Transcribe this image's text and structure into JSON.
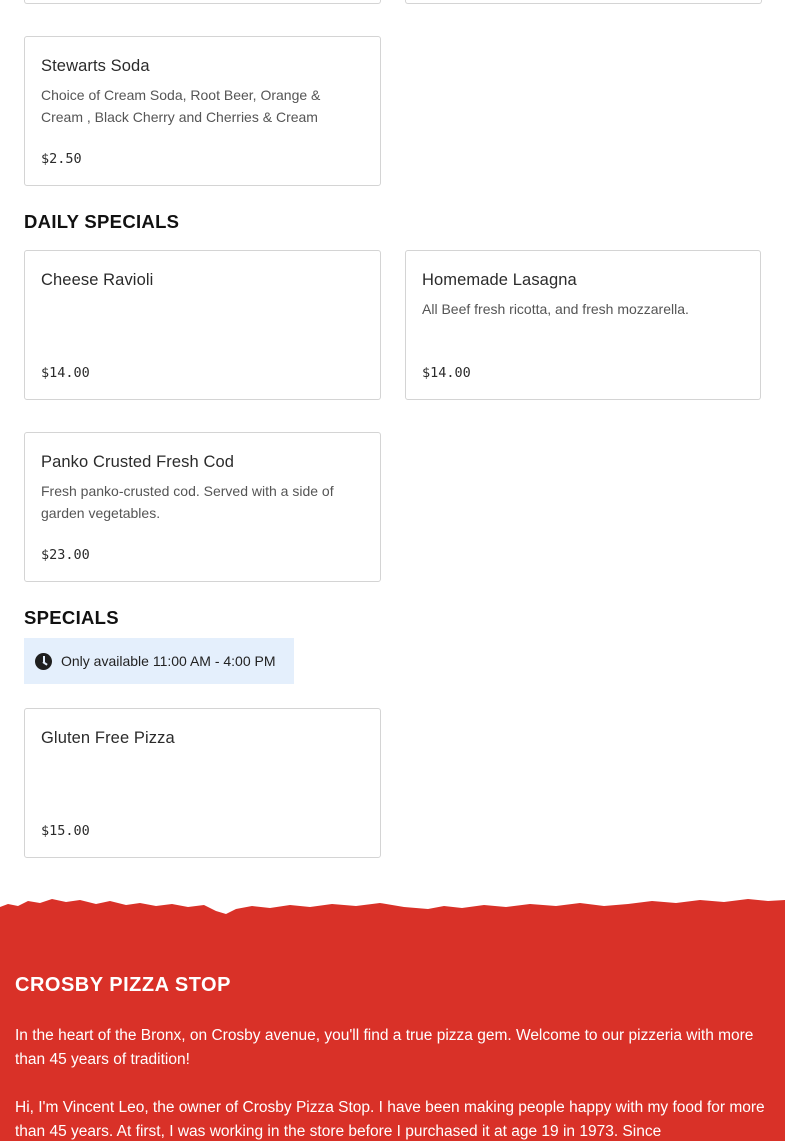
{
  "menu": {
    "top_items": [
      {
        "name": "Stewarts Soda",
        "description": "Choice of Cream Soda, Root Beer, Orange & Cream , Black Cherry and Cherries & Cream",
        "price": "$2.50"
      }
    ],
    "daily_specials": {
      "title": "DAILY SPECIALS",
      "items": [
        {
          "name": "Cheese Ravioli",
          "description": "",
          "price": "$14.00"
        },
        {
          "name": "Homemade Lasagna",
          "description": "All Beef fresh ricotta, and fresh mozzarella.",
          "price": "$14.00"
        },
        {
          "name": "Panko Crusted Fresh Cod",
          "description": "Fresh panko-crusted cod. Served with a side of garden vegetables.",
          "price": "$23.00"
        }
      ]
    },
    "specials": {
      "title": "SPECIALS",
      "availability": "Only available 11:00 AM - 4:00 PM",
      "items": [
        {
          "name": "Gluten Free Pizza",
          "description": "",
          "price": "$15.00"
        }
      ]
    }
  },
  "footer": {
    "brand": "CROSBY PIZZA STOP",
    "paragraphs": [
      "In the heart of the Bronx, on Crosby avenue, you'll find a true pizza gem. Welcome to our pizzeria with more than 45 years of tradition!",
      "Hi, I'm Vincent Leo, the owner of Crosby Pizza Stop. I have been making people happy with my food for more than 45 years. At first, I was working in the store before I purchased it at age 19 in 1973. Since"
    ]
  },
  "colors": {
    "footer_red": "#d93128",
    "availability_bg": "#e4effc",
    "card_border": "#d4d4d4"
  },
  "icons": {
    "availability": "clock-icon"
  }
}
